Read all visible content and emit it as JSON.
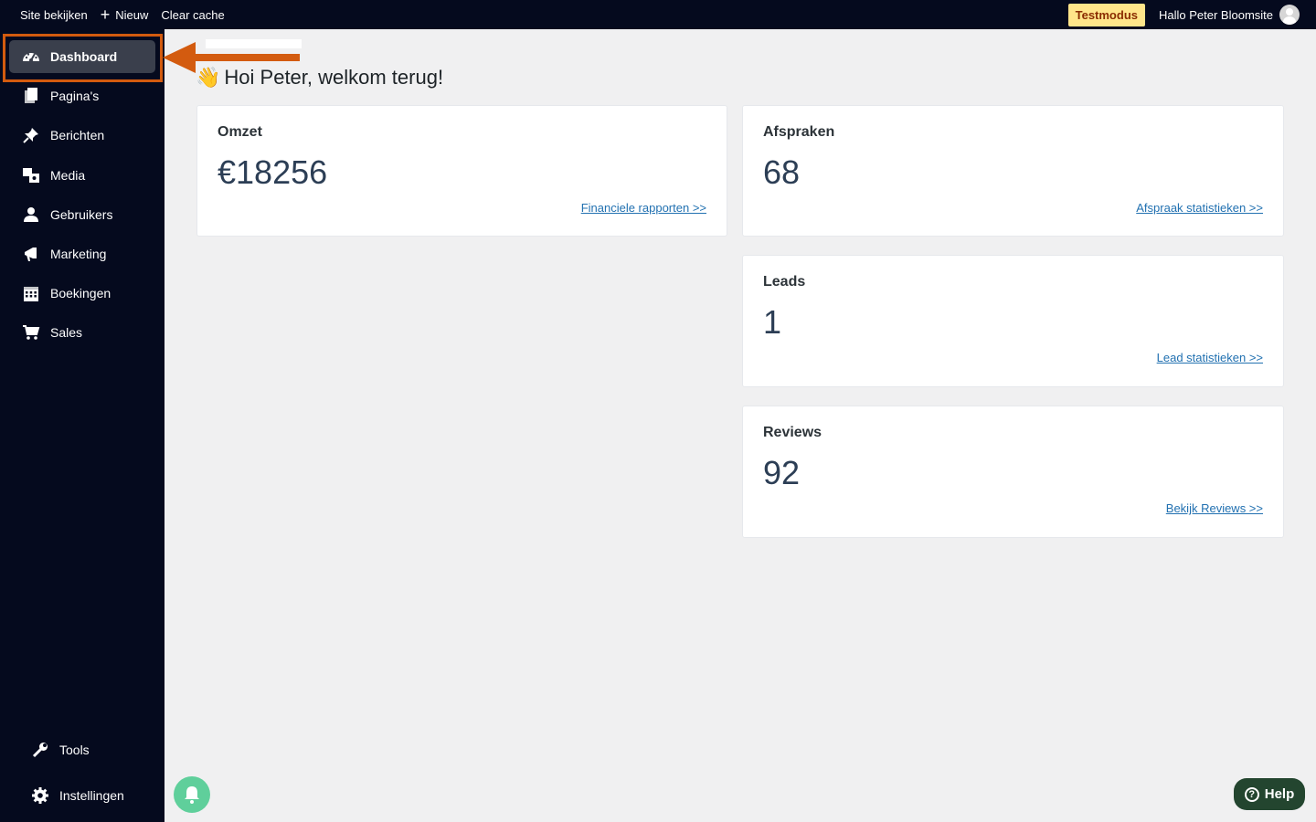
{
  "topbar": {
    "site_view": "Site bekijken",
    "new": "Nieuw",
    "clear_cache": "Clear cache",
    "badge": "Testmodus",
    "greeting": "Hallo Peter Bloomsite"
  },
  "sidebar": {
    "items": [
      {
        "label": "Dashboard",
        "icon": "dashboard-icon"
      },
      {
        "label": "Pagina's",
        "icon": "pages-icon"
      },
      {
        "label": "Berichten",
        "icon": "pin-icon"
      },
      {
        "label": "Media",
        "icon": "media-icon"
      },
      {
        "label": "Gebruikers",
        "icon": "user-icon"
      },
      {
        "label": "Marketing",
        "icon": "megaphone-icon"
      },
      {
        "label": "Boekingen",
        "icon": "calendar-icon"
      },
      {
        "label": "Sales",
        "icon": "cart-icon"
      }
    ],
    "bottom": [
      {
        "label": "Tools",
        "icon": "wrench-icon"
      },
      {
        "label": "Instellingen",
        "icon": "gear-icon"
      }
    ]
  },
  "main": {
    "heading": "Hoi Peter, welkom terug!",
    "cards": {
      "omzet": {
        "title": "Omzet",
        "value": "€18256",
        "link": "Financiele rapporten >>"
      },
      "afspraken": {
        "title": "Afspraken",
        "value": "68",
        "link": "Afspraak statistieken >>"
      },
      "leads": {
        "title": "Leads",
        "value": "1",
        "link": "Lead statistieken >>"
      },
      "reviews": {
        "title": "Reviews",
        "value": "92",
        "link": "Bekijk Reviews >>"
      }
    }
  },
  "help": {
    "label": "Help"
  },
  "colors": {
    "accent": "#d35b0f",
    "sidebar": "#050a1e",
    "link": "#2271b1",
    "badge": "#ffe58a"
  }
}
